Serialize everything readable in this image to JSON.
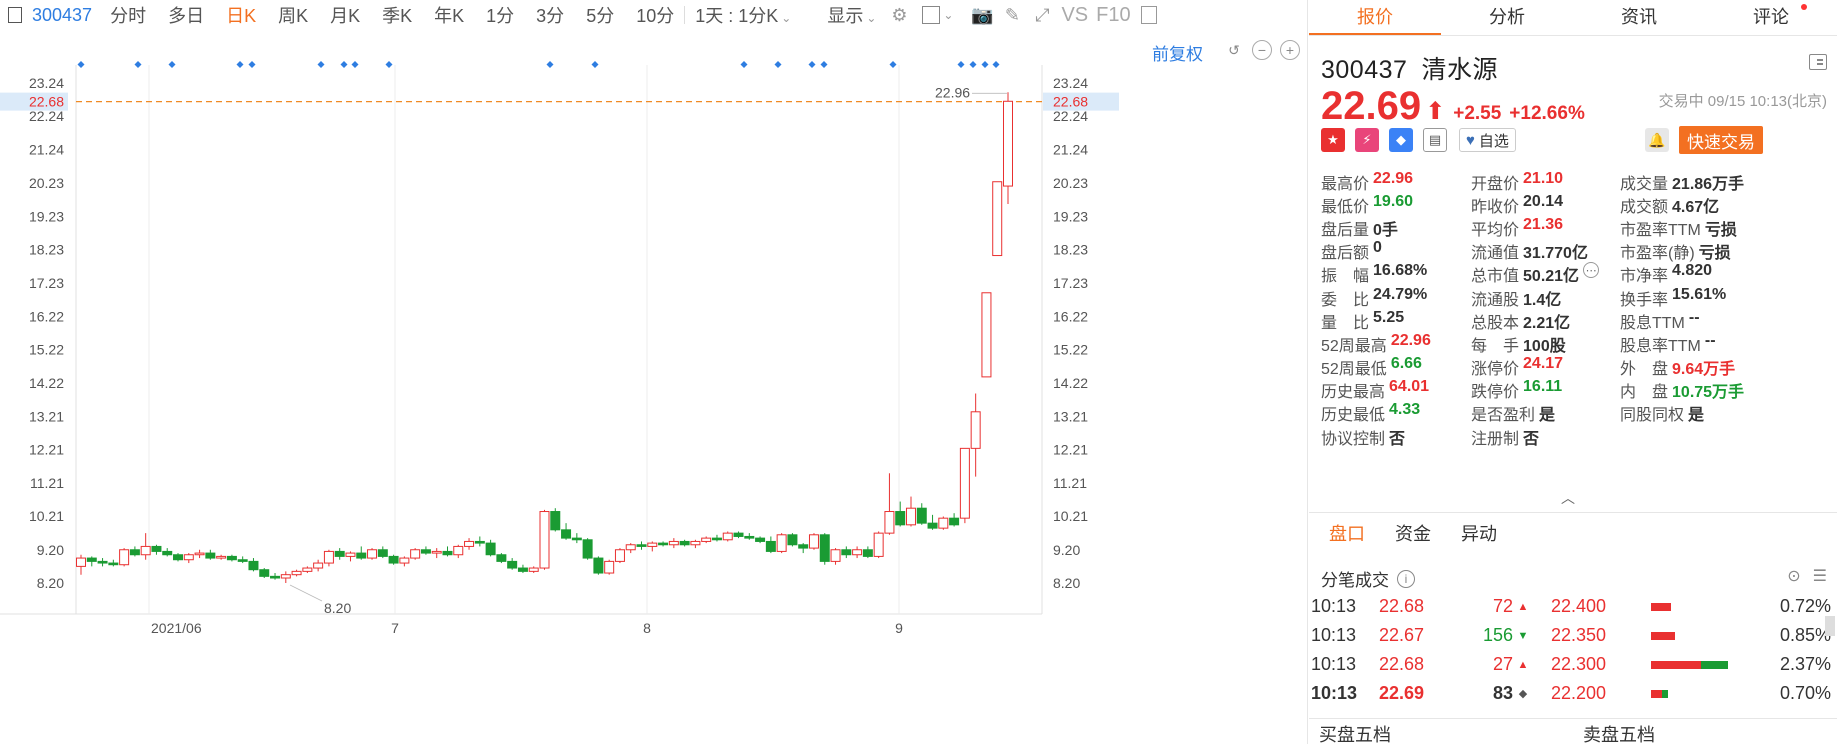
{
  "toolbar": {
    "code": "300437",
    "periods": [
      "分时",
      "多日",
      "日K",
      "周K",
      "月K",
      "季K",
      "年K",
      "1分",
      "3分",
      "5分",
      "10分"
    ],
    "selected_period": "日K",
    "range_select": "1天 : 1分K",
    "display_label": "显示",
    "vs_label": "VS",
    "f10_label": "F10"
  },
  "chart": {
    "fuquan_label": "前复权",
    "current_price_label": "22.68",
    "high_annotation": "22.96",
    "low_annotation": "8.20",
    "y_ticks": [
      "23.24",
      "22.24",
      "21.24",
      "20.23",
      "19.23",
      "18.23",
      "17.23",
      "16.22",
      "15.22",
      "14.22",
      "13.21",
      "12.21",
      "11.21",
      "10.21",
      "9.20",
      "8.20"
    ],
    "x_labels": [
      "2021/06",
      "7",
      "8",
      "9"
    ],
    "colors": {
      "up": "#e93030",
      "down": "#1a9b33",
      "guide": "#f08a24",
      "marker": "#2e7de1"
    }
  },
  "chart_data": {
    "type": "candlestick",
    "ylim": [
      8.2,
      23.24
    ],
    "ohlc": [
      [
        8.7,
        9.05,
        8.45,
        8.95
      ],
      [
        8.95,
        9.0,
        8.7,
        8.85
      ],
      [
        8.85,
        8.95,
        8.7,
        8.8
      ],
      [
        8.8,
        8.9,
        8.7,
        8.75
      ],
      [
        8.75,
        9.25,
        8.7,
        9.2
      ],
      [
        9.2,
        9.3,
        9.0,
        9.05
      ],
      [
        9.05,
        9.7,
        8.9,
        9.3
      ],
      [
        9.3,
        9.35,
        9.05,
        9.15
      ],
      [
        9.15,
        9.25,
        9.0,
        9.05
      ],
      [
        9.05,
        9.1,
        8.85,
        8.9
      ],
      [
        8.9,
        9.1,
        8.8,
        9.05
      ],
      [
        9.05,
        9.2,
        8.95,
        9.1
      ],
      [
        9.1,
        9.2,
        8.9,
        8.95
      ],
      [
        8.95,
        9.05,
        8.9,
        9.0
      ],
      [
        9.0,
        9.05,
        8.85,
        8.9
      ],
      [
        8.9,
        9.0,
        8.8,
        8.85
      ],
      [
        8.85,
        8.95,
        8.55,
        8.6
      ],
      [
        8.6,
        8.65,
        8.35,
        8.4
      ],
      [
        8.4,
        8.5,
        8.3,
        8.35
      ],
      [
        8.35,
        8.55,
        8.2,
        8.45
      ],
      [
        8.45,
        8.6,
        8.4,
        8.55
      ],
      [
        8.55,
        8.7,
        8.5,
        8.65
      ],
      [
        8.65,
        8.9,
        8.55,
        8.8
      ],
      [
        8.8,
        9.2,
        8.7,
        9.15
      ],
      [
        9.15,
        9.25,
        8.9,
        9.0
      ],
      [
        9.0,
        9.15,
        8.85,
        9.1
      ],
      [
        9.1,
        9.3,
        8.9,
        8.95
      ],
      [
        8.95,
        9.25,
        8.9,
        9.2
      ],
      [
        9.2,
        9.3,
        8.95,
        9.0
      ],
      [
        9.0,
        9.05,
        8.75,
        8.8
      ],
      [
        8.8,
        9.0,
        8.7,
        8.95
      ],
      [
        8.95,
        9.25,
        8.9,
        9.2
      ],
      [
        9.2,
        9.3,
        9.05,
        9.1
      ],
      [
        9.1,
        9.25,
        8.95,
        9.15
      ],
      [
        9.15,
        9.3,
        9.0,
        9.05
      ],
      [
        9.05,
        9.35,
        8.95,
        9.3
      ],
      [
        9.3,
        9.55,
        9.2,
        9.45
      ],
      [
        9.45,
        9.6,
        9.3,
        9.4
      ],
      [
        9.4,
        9.5,
        9.0,
        9.05
      ],
      [
        9.05,
        9.1,
        8.8,
        8.85
      ],
      [
        8.85,
        8.95,
        8.6,
        8.65
      ],
      [
        8.65,
        8.75,
        8.5,
        8.55
      ],
      [
        8.55,
        8.7,
        8.5,
        8.65
      ],
      [
        8.65,
        10.4,
        8.6,
        10.35
      ],
      [
        10.35,
        10.45,
        9.75,
        9.8
      ],
      [
        9.8,
        10.0,
        9.5,
        9.55
      ],
      [
        9.55,
        9.7,
        9.4,
        9.5
      ],
      [
        9.5,
        9.55,
        8.9,
        8.95
      ],
      [
        8.95,
        9.0,
        8.45,
        8.5
      ],
      [
        8.5,
        8.9,
        8.45,
        8.85
      ],
      [
        8.85,
        9.25,
        8.8,
        9.2
      ],
      [
        9.2,
        9.4,
        9.1,
        9.35
      ],
      [
        9.35,
        9.45,
        9.2,
        9.3
      ],
      [
        9.3,
        9.45,
        9.15,
        9.4
      ],
      [
        9.4,
        9.45,
        9.3,
        9.35
      ],
      [
        9.35,
        9.55,
        9.25,
        9.45
      ],
      [
        9.45,
        9.5,
        9.3,
        9.35
      ],
      [
        9.35,
        9.5,
        9.25,
        9.45
      ],
      [
        9.45,
        9.6,
        9.4,
        9.55
      ],
      [
        9.55,
        9.65,
        9.45,
        9.5
      ],
      [
        9.5,
        9.75,
        9.45,
        9.7
      ],
      [
        9.7,
        9.75,
        9.55,
        9.6
      ],
      [
        9.6,
        9.7,
        9.5,
        9.55
      ],
      [
        9.55,
        9.6,
        9.4,
        9.45
      ],
      [
        9.45,
        9.6,
        9.1,
        9.15
      ],
      [
        9.15,
        9.7,
        9.1,
        9.65
      ],
      [
        9.65,
        9.7,
        9.3,
        9.35
      ],
      [
        9.35,
        9.4,
        9.1,
        9.25
      ],
      [
        9.25,
        9.7,
        9.2,
        9.65
      ],
      [
        9.65,
        9.7,
        8.75,
        8.85
      ],
      [
        8.85,
        9.25,
        8.75,
        9.2
      ],
      [
        9.2,
        9.3,
        8.95,
        9.05
      ],
      [
        9.05,
        9.3,
        8.95,
        9.2
      ],
      [
        9.2,
        9.3,
        8.95,
        9.0
      ],
      [
        9.0,
        9.75,
        8.95,
        9.7
      ],
      [
        9.7,
        11.5,
        9.65,
        10.35
      ],
      [
        10.35,
        10.65,
        9.9,
        9.95
      ],
      [
        9.95,
        10.8,
        9.9,
        10.45
      ],
      [
        10.45,
        10.6,
        9.95,
        10.0
      ],
      [
        10.0,
        10.25,
        9.8,
        9.85
      ],
      [
        9.85,
        10.2,
        9.8,
        10.15
      ],
      [
        10.15,
        10.3,
        9.9,
        9.95
      ],
      [
        10.15,
        12.25,
        10.0,
        12.25
      ],
      [
        12.25,
        13.9,
        11.4,
        13.35
      ],
      [
        14.4,
        16.93,
        14.4,
        16.93
      ],
      [
        18.05,
        20.27,
        18.05,
        20.27
      ],
      [
        20.14,
        22.96,
        19.6,
        22.69
      ]
    ]
  },
  "top_tabs": [
    "报价",
    "分析",
    "资讯",
    "评论"
  ],
  "stock": {
    "code": "300437",
    "name": "清水源",
    "price": "22.69",
    "change": "+2.55",
    "change_pct": "+12.66%",
    "trade_time": "交易中 09/15 10:13(北京)",
    "zixuan_label": "自选",
    "quick_trade_label": "快速交易"
  },
  "stats": [
    [
      {
        "label": "最高价",
        "value": "22.96",
        "color": "red"
      },
      {
        "label": "开盘价",
        "value": "21.10",
        "color": "red"
      },
      {
        "label": "成交量",
        "value": "21.86万手",
        "color": ""
      }
    ],
    [
      {
        "label": "最低价",
        "value": "19.60",
        "color": "green"
      },
      {
        "label": "昨收价",
        "value": "20.14",
        "color": ""
      },
      {
        "label": "成交额",
        "value": "4.67亿",
        "color": ""
      }
    ],
    [
      {
        "label": "盘后量",
        "value": "0手",
        "color": ""
      },
      {
        "label": "平均价",
        "value": "21.36",
        "color": "red"
      },
      {
        "label": "市盈率TTM",
        "value": "亏损",
        "color": ""
      }
    ],
    [
      {
        "label": "盘后额",
        "value": "0",
        "color": ""
      },
      {
        "label": "流通值",
        "value": "31.770亿",
        "color": ""
      },
      {
        "label": "市盈率(静)",
        "value": "亏损",
        "color": ""
      }
    ],
    [
      {
        "label": "振　幅",
        "value": "16.68%",
        "color": ""
      },
      {
        "label": "总市值",
        "value": "50.21亿",
        "color": ""
      },
      {
        "label": "市净率",
        "value": "4.820",
        "color": ""
      }
    ],
    [
      {
        "label": "委　比",
        "value": "24.79%",
        "color": ""
      },
      {
        "label": "流通股",
        "value": "1.4亿",
        "color": ""
      },
      {
        "label": "换手率",
        "value": "15.61%",
        "color": ""
      }
    ],
    [
      {
        "label": "量　比",
        "value": "5.25",
        "color": ""
      },
      {
        "label": "总股本",
        "value": "2.21亿",
        "color": ""
      },
      {
        "label": "股息TTM",
        "value": "--",
        "color": ""
      }
    ],
    [
      {
        "label": "52周最高",
        "value": "22.96",
        "color": "red"
      },
      {
        "label": "每　手",
        "value": "100股",
        "color": ""
      },
      {
        "label": "股息率TTM",
        "value": "--",
        "color": ""
      }
    ],
    [
      {
        "label": "52周最低",
        "value": "6.66",
        "color": "green"
      },
      {
        "label": "涨停价",
        "value": "24.17",
        "color": "red"
      },
      {
        "label": "外　盘",
        "value": "9.64万手",
        "color": "red"
      }
    ],
    [
      {
        "label": "历史最高",
        "value": "64.01",
        "color": "red"
      },
      {
        "label": "跌停价",
        "value": "16.11",
        "color": "green"
      },
      {
        "label": "内　盘",
        "value": "10.75万手",
        "color": "green"
      }
    ],
    [
      {
        "label": "历史最低",
        "value": "4.33",
        "color": "green"
      },
      {
        "label": "是否盈利",
        "value": "是",
        "color": ""
      },
      {
        "label": "同股同权",
        "value": "是",
        "color": ""
      }
    ],
    [
      {
        "label": "协议控制",
        "value": "否",
        "color": ""
      },
      {
        "label": "注册制",
        "value": "否",
        "color": ""
      },
      {
        "label": "",
        "value": "",
        "color": ""
      }
    ]
  ],
  "sub_tabs": [
    "盘口",
    "资金",
    "异动"
  ],
  "fenbi_title": "分笔成交",
  "trades": [
    {
      "time": "10:13",
      "price": "22.68",
      "vol": "72",
      "dir": "up"
    },
    {
      "time": "10:13",
      "price": "22.67",
      "vol": "156",
      "dir": "down"
    },
    {
      "time": "10:13",
      "price": "22.68",
      "vol": "27",
      "dir": "up"
    },
    {
      "time": "10:13",
      "price": "22.69",
      "vol": "83",
      "dir": "neutral"
    }
  ],
  "depth": [
    {
      "price": "22.400",
      "pct": "0.72%",
      "red": 0.18,
      "green": 0
    },
    {
      "price": "22.350",
      "pct": "0.85%",
      "red": 0.22,
      "green": 0
    },
    {
      "price": "22.300",
      "pct": "2.37%",
      "red": 0.45,
      "green": 0.25
    },
    {
      "price": "22.200",
      "pct": "0.70%",
      "red": 0.1,
      "green": 0.05
    }
  ],
  "bottom": {
    "buy5": "买盘五档",
    "sell5": "卖盘五档"
  }
}
